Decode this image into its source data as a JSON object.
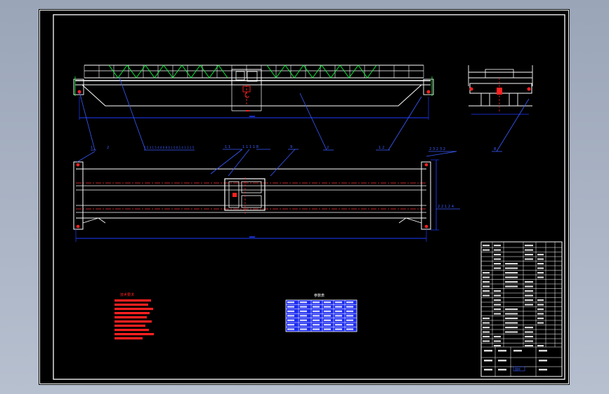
{
  "drawing": {
    "balloons": [
      "1",
      "2",
      "1 5 3 1 5 4 4 0 8 0 1 0 0 1 4 1 3 1 5",
      "1 1",
      "1 1 1 1 8",
      "9",
      "2",
      "1 2",
      "2 3 2 3 2",
      "2 2 1 2 4",
      "8"
    ],
    "notes_title": "技术要求",
    "table_title": "参数表",
    "title_block_label": "图样"
  },
  "colors": {
    "page_background": "#a9b3c4",
    "sheet": "#000000",
    "frame": "#ffffff",
    "structure": "#ffffff",
    "dimension": "#1e3cff",
    "balloon": "#3a5bff",
    "notes": "#ff2020",
    "center_line": "#ff3030",
    "truss_zigzag": "#00ff3c",
    "param_table_fill": "#1e2df0",
    "accent": "#ffff00"
  }
}
